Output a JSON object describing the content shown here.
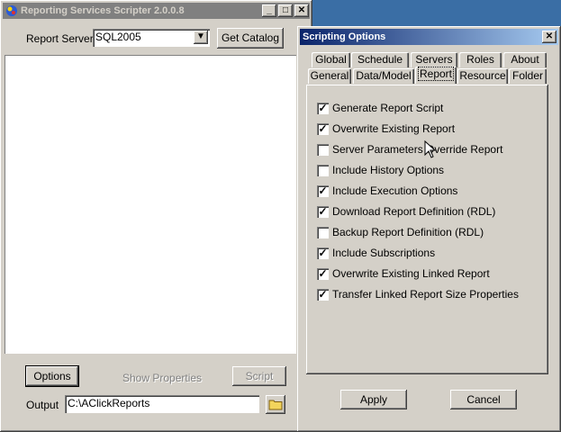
{
  "main_window": {
    "title": "Reporting Services Scripter 2.0.0.8",
    "minimize_glyph": "_",
    "maximize_glyph": "□",
    "close_glyph": "✕",
    "report_server_label": "Report Server",
    "report_server_value": "SQL2005",
    "get_catalog_label": "Get Catalog",
    "options_label": "Options",
    "show_properties_label": "Show Properties",
    "script_label": "Script",
    "output_label": "Output",
    "output_value": "C:\\AClickReports"
  },
  "dialog": {
    "title": "Scripting Options",
    "close_glyph": "✕",
    "tabs_back": [
      "Global",
      "Schedule",
      "Servers",
      "Roles",
      "About"
    ],
    "tabs_front": [
      "General",
      "Data/Model",
      "Report",
      "Resource",
      "Folder"
    ],
    "selected_tab": "Report",
    "options": [
      {
        "label": "Generate Report Script",
        "checked": true
      },
      {
        "label": "Overwrite Existing Report",
        "checked": true
      },
      {
        "label": "Server Parameters Override Report",
        "checked": false
      },
      {
        "label": "Include History Options",
        "checked": false
      },
      {
        "label": "Include Execution Options",
        "checked": true
      },
      {
        "label": "Download Report Definition (RDL)",
        "checked": true
      },
      {
        "label": "Backup Report Definition (RDL)",
        "checked": false
      },
      {
        "label": "Include Subscriptions",
        "checked": true
      },
      {
        "label": "Overwrite Existing Linked Report",
        "checked": true
      },
      {
        "label": "Transfer Linked Report Size Properties",
        "checked": true
      }
    ],
    "apply_label": "Apply",
    "cancel_label": "Cancel",
    "check_glyph": "✓"
  }
}
